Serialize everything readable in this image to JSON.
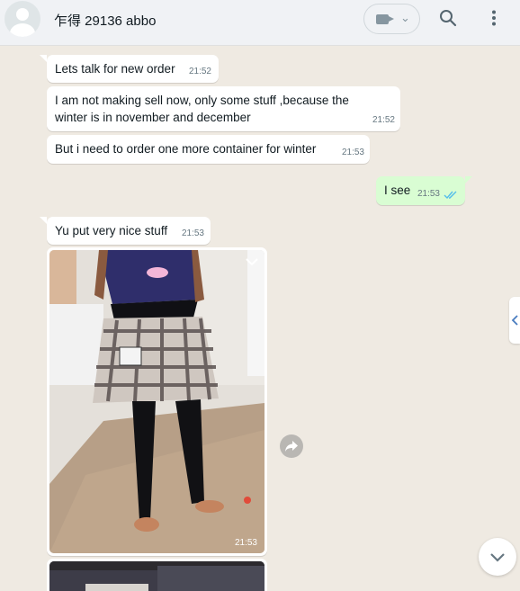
{
  "header": {
    "contact_name": "乍得 29136 abbo",
    "icons": {
      "avatar": "default-avatar",
      "video": "video-camera-icon",
      "search": "search-icon",
      "menu": "kebab-menu-icon"
    }
  },
  "messages": [
    {
      "direction": "in",
      "text": "Lets talk for new order",
      "time": "21:52"
    },
    {
      "direction": "in",
      "text_line1": "I am not making sell now, only some stuff ,because the",
      "text_line2": "winter is in november and december",
      "time": "21:52"
    },
    {
      "direction": "in",
      "text": "But i need to order one more container for winter",
      "time": "21:53"
    },
    {
      "direction": "out",
      "text": "I see",
      "time": "21:53",
      "status": "read"
    },
    {
      "direction": "in",
      "text": "Yu put very nice stuff",
      "time": "21:53"
    },
    {
      "direction": "in",
      "type": "image",
      "description": "child wearing plaid skirt and black leggings",
      "time": "21:53"
    }
  ],
  "colors": {
    "chat_bg": "#efeae2",
    "incoming": "#ffffff",
    "outgoing": "#d9fdd3",
    "read_ticks": "#53bdeb"
  }
}
